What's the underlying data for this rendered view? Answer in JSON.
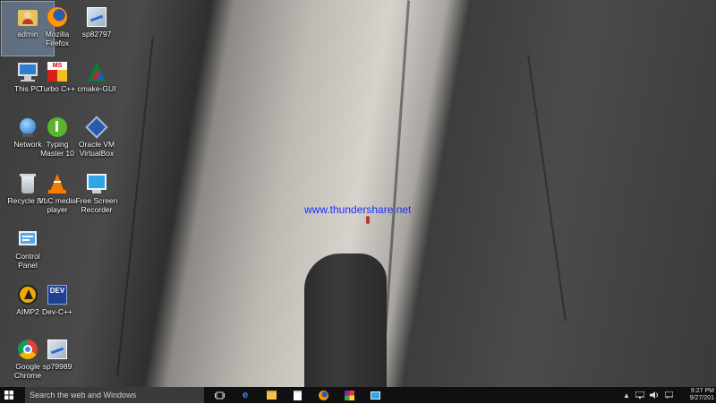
{
  "desktop": {
    "watermark": "www.thundershare.net",
    "icons": [
      {
        "label": "admin",
        "icon": "user-folder-icon"
      },
      {
        "label": "This PC",
        "icon": "computer-icon"
      },
      {
        "label": "Network",
        "icon": "network-icon"
      },
      {
        "label": "Recycle Bin",
        "icon": "recycle-bin-icon"
      },
      {
        "label": "Control\nPanel",
        "icon": "control-panel-icon"
      },
      {
        "label": "AIMP2",
        "icon": "aimp-icon"
      },
      {
        "label": "Google\nChrome",
        "icon": "chrome-icon"
      },
      {
        "label": "Mozilla\nFirefox",
        "icon": "firefox-icon"
      },
      {
        "label": "Turbo C++",
        "icon": "turbo-cpp-icon"
      },
      {
        "label": "Typing\nMaster 10",
        "icon": "typing-master-icon"
      },
      {
        "label": "VLC media\nplayer",
        "icon": "vlc-icon"
      },
      {
        "label": "Dev-C++",
        "icon": "dev-cpp-icon"
      },
      {
        "label": "sp82797",
        "icon": "installer-icon"
      },
      {
        "label": "cmake-GUI",
        "icon": "cmake-icon"
      },
      {
        "label": "Oracle VM\nVirtualBox",
        "icon": "virtualbox-icon"
      },
      {
        "label": "Free Screen\nRecorder",
        "icon": "screen-recorder-icon"
      },
      {
        "label": "sp79989",
        "icon": "installer-icon"
      }
    ]
  },
  "taskbar": {
    "search_placeholder": "Search the web and Windows",
    "time": "9:27 PM",
    "date": "9/27/201"
  }
}
